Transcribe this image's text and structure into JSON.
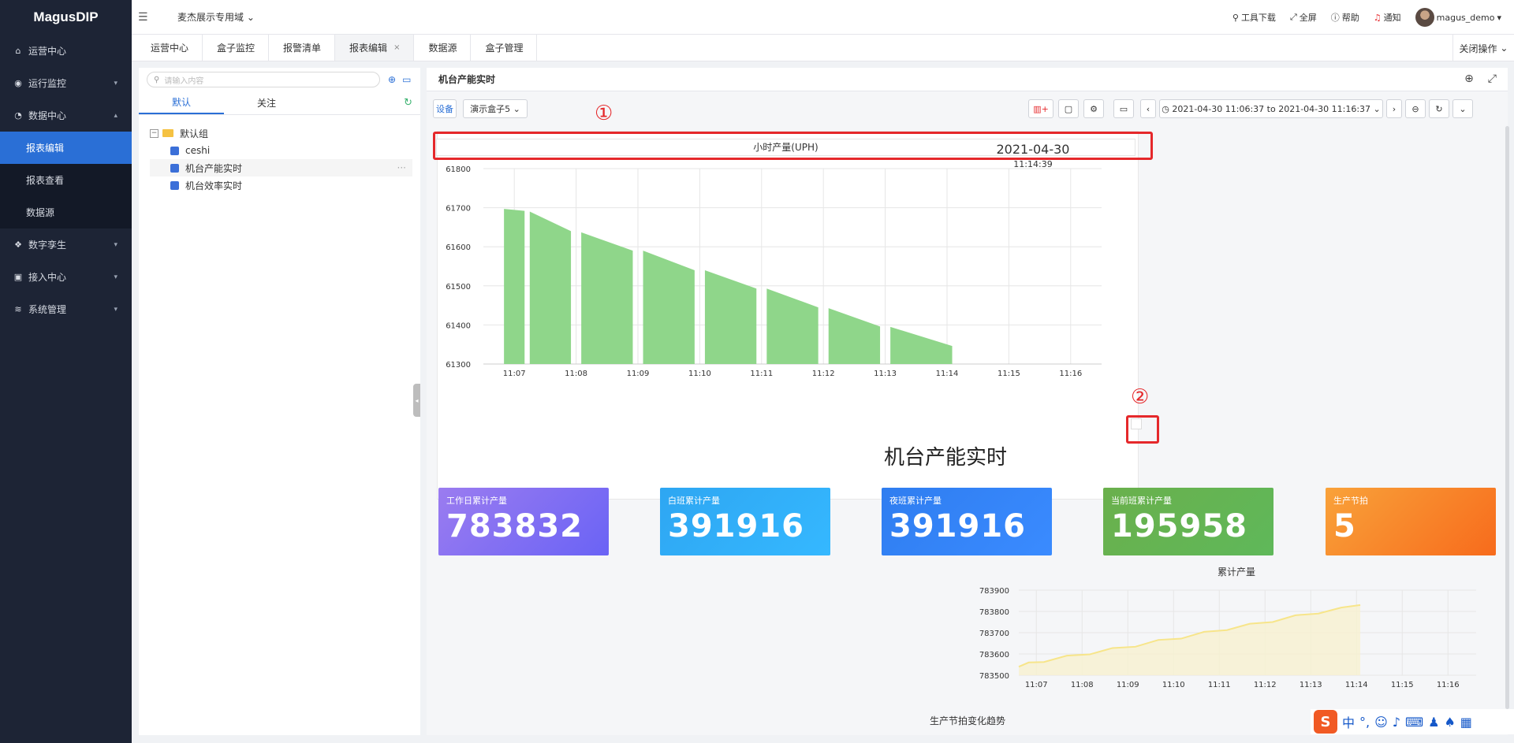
{
  "brand": "MagusDIP",
  "domain_select": "麦杰展示专用域",
  "top_right": {
    "tools": "工具下载",
    "fullscreen": "全屏",
    "help": "帮助",
    "notify": "通知",
    "user": "magus_demo"
  },
  "sidebar": {
    "items": [
      {
        "label": "运营中心",
        "icon": "home-icon"
      },
      {
        "label": "运行监控",
        "icon": "location-icon"
      },
      {
        "label": "数据中心",
        "icon": "data-icon"
      },
      {
        "label": "数字孪生",
        "icon": "twin-icon"
      },
      {
        "label": "接入中心",
        "icon": "plug-icon"
      },
      {
        "label": "系统管理",
        "icon": "layers-icon"
      }
    ],
    "subitems": [
      "报表编辑",
      "报表查看",
      "数据源"
    ]
  },
  "tabs": [
    "运营中心",
    "盒子监控",
    "报警清单",
    "报表编辑",
    "数据源",
    "盒子管理"
  ],
  "close_ops": "关闭操作",
  "left_panel": {
    "search_placeholder": "请输入内容",
    "subtab_default": "默认",
    "subtab_follow": "关注",
    "group": "默认组",
    "reports": [
      "ceshi",
      "机台产能实时",
      "机台效率实时"
    ]
  },
  "main": {
    "title": "机台产能实时",
    "device_btn": "设备",
    "box_select": "演示盒子5",
    "time_range": "2021-04-30 11:06:37 to 2021-04-30 11:16:37",
    "clock_date": "2021-04-30",
    "clock_time": "11:14:39",
    "big_title": "机台产能实时",
    "annotation_1": "①",
    "annotation_2": "②",
    "kpis": [
      {
        "label": "工作日累计产量",
        "value": "783832",
        "from": "#9b7cf0",
        "to": "#6a63f5"
      },
      {
        "label": "白班累计产量",
        "value": "391916",
        "from": "#2ea6f2",
        "to": "#35b8ff"
      },
      {
        "label": "夜班累计产量",
        "value": "391916",
        "from": "#2f7df0",
        "to": "#3a8bff"
      },
      {
        "label": "当前班累计产量",
        "value": "195958",
        "from": "#6ab04c",
        "to": "#5fb85a"
      },
      {
        "label": "生产节拍",
        "value": "5",
        "from": "#f9a23a",
        "to": "#f76b1c"
      }
    ],
    "trend_title": "生产节拍变化趋势"
  },
  "chart_data": [
    {
      "type": "area",
      "title": "小时产量(UPH)",
      "x": [
        "11:07",
        "11:08",
        "11:09",
        "11:10",
        "11:11",
        "11:12",
        "11:13",
        "11:14",
        "11:15",
        "11:16"
      ],
      "ylim": [
        61300,
        61800
      ],
      "yticks": [
        "61800",
        "61700",
        "61600",
        "61500",
        "61400",
        "61300"
      ],
      "segments": [
        {
          "start": "11:06:50",
          "end": "11:07:10",
          "y0": 61697,
          "y1": 61692
        },
        {
          "start": "11:07:15",
          "end": "11:07:55",
          "y0": 61690,
          "y1": 61640
        },
        {
          "start": "11:08:05",
          "end": "11:08:55",
          "y0": 61637,
          "y1": 61590
        },
        {
          "start": "11:09:05",
          "end": "11:09:55",
          "y0": 61590,
          "y1": 61540
        },
        {
          "start": "11:10:05",
          "end": "11:10:55",
          "y0": 61540,
          "y1": 61493
        },
        {
          "start": "11:11:05",
          "end": "11:11:55",
          "y0": 61493,
          "y1": 61445
        },
        {
          "start": "11:12:05",
          "end": "11:12:55",
          "y0": 61443,
          "y1": 61396
        },
        {
          "start": "11:13:05",
          "end": "11:14:05",
          "y0": 61395,
          "y1": 61346
        }
      ],
      "grid": true,
      "color": "#8fd68a"
    },
    {
      "type": "area",
      "title": "累计产量",
      "x": [
        "11:07",
        "11:08",
        "11:09",
        "11:10",
        "11:11",
        "11:12",
        "11:13",
        "11:14",
        "11:15",
        "11:16"
      ],
      "ylim": [
        783500,
        783900
      ],
      "yticks": [
        "783900",
        "783800",
        "783700",
        "783600",
        "783500"
      ],
      "points": [
        [
          "11:06:37",
          783540
        ],
        [
          "11:06:50",
          783560
        ],
        [
          "11:07:10",
          783562
        ],
        [
          "11:07:40",
          783592
        ],
        [
          "11:08:10",
          783598
        ],
        [
          "11:08:40",
          783628
        ],
        [
          "11:09:10",
          783634
        ],
        [
          "11:09:40",
          783666
        ],
        [
          "11:10:10",
          783672
        ],
        [
          "11:10:40",
          783704
        ],
        [
          "11:11:10",
          783712
        ],
        [
          "11:11:40",
          783742
        ],
        [
          "11:12:10",
          783750
        ],
        [
          "11:12:40",
          783782
        ],
        [
          "11:13:10",
          783790
        ],
        [
          "11:13:40",
          783818
        ],
        [
          "11:14:05",
          783830
        ]
      ],
      "grid": true,
      "color": "#f7e58a"
    }
  ]
}
